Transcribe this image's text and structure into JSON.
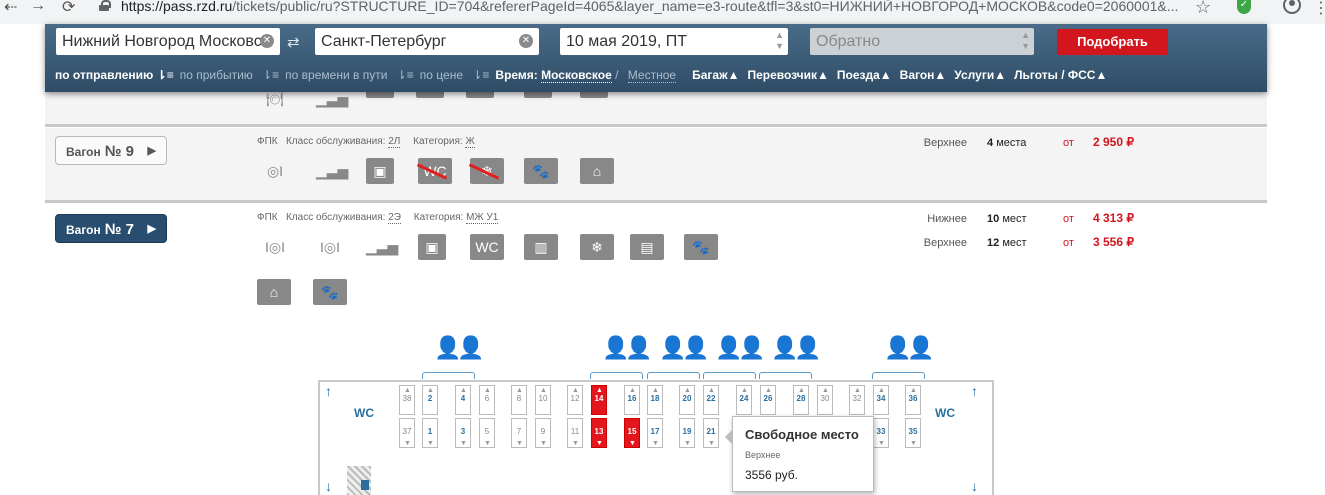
{
  "browser": {
    "url_host": "https://pass.rzd.ru",
    "url_rest": "/tickets/public/ru?STRUCTURE_ID=704&refererPageId=4065&layer_name=e3-route&tfl=3&st0=НИЖНИЙ+НОВГОРОД+МОСКОВ&code0=2060001&..."
  },
  "search": {
    "from": "Нижний Новгород Московс",
    "to": "Санкт-Петербург",
    "date": "10 мая 2019, ПТ",
    "back_placeholder": "Обратно",
    "submit": "Подобрать"
  },
  "sort": {
    "dep": "по отправлению",
    "arr": "по прибытию",
    "travel": "по времени в пути",
    "price": "по цене",
    "time_label": "Время:",
    "moscow": "Московское",
    "slash": "/",
    "local": "Местное",
    "filters": [
      "Багаж",
      "Перевозчик",
      "Поезда",
      "Вагон",
      "Услуги",
      "Льготы / ФСС"
    ]
  },
  "wagon9": {
    "label": "Вагон",
    "num": "№ 9",
    "carrier": "ФПК",
    "class_label": "Класс обслуживания:",
    "class": "2Л",
    "cat_label": "Категория:",
    "cat": "Ж",
    "seat_type": "Верхнее",
    "count": "4",
    "count_unit": "места",
    "from": "от",
    "price": "2 950 ₽"
  },
  "wagon7": {
    "label": "Вагон",
    "num": "№ 7",
    "carrier": "ФПК",
    "class_label": "Класс обслуживания:",
    "class": "2Э",
    "cat_label": "Категория:",
    "cat": "МЖ У1",
    "prices": [
      {
        "type": "Нижнее",
        "count": "10",
        "unit": "мест",
        "from": "от",
        "price": "4 313 ₽"
      },
      {
        "type": "Верхнее",
        "count": "12",
        "unit": "мест",
        "from": "от",
        "price": "3 556 ₽"
      }
    ]
  },
  "scheme": {
    "wc": "WC",
    "top": [
      "38",
      "2",
      "4",
      "6",
      "8",
      "10",
      "12",
      "14",
      "16",
      "18",
      "20",
      "22",
      "24",
      "26",
      "28",
      "30",
      "32",
      "34",
      "36"
    ],
    "bottom": [
      "37",
      "1",
      "3",
      "5",
      "7",
      "9",
      "11",
      "13",
      "15",
      "17",
      "19",
      "21",
      "",
      "",
      "",
      "",
      "",
      "33",
      "35"
    ]
  },
  "tooltip": {
    "title": "Свободное место",
    "type": "Верхнее",
    "price": "3556 руб."
  }
}
